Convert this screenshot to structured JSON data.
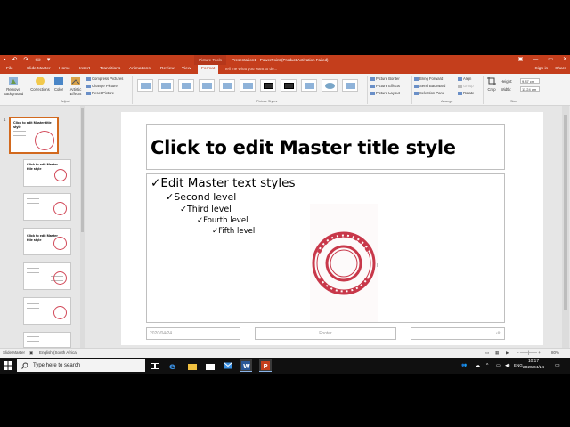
{
  "window": {
    "context_tab": "Picture Tools",
    "title": "Presentation1 - PowerPoint (Product Activation Failed)",
    "controls": [
      "—",
      "▭",
      "✕"
    ]
  },
  "tabs": [
    "File",
    "Slide Master",
    "Home",
    "Insert",
    "Transitions",
    "Animations",
    "Review",
    "View",
    "Format"
  ],
  "active_tab": "Format",
  "tell_me": "Tell me what you want to do...",
  "account": {
    "sign_in": "Sign in",
    "share": "Share"
  },
  "ribbon": {
    "remove_background": "Remove Background",
    "corrections": "Corrections",
    "color": "Color",
    "artistic_effects": "Artistic Effects",
    "compress": "Compress Pictures",
    "change": "Change Picture",
    "reset": "Reset Picture",
    "adjust_group": "Adjust",
    "styles_group": "Picture Styles",
    "picture_border": "Picture Border",
    "picture_effects": "Picture Effects",
    "picture_layout": "Picture Layout",
    "bring_forward": "Bring Forward",
    "send_backward": "Send Backward",
    "selection_pane": "Selection Pane",
    "align": "Align",
    "group": "Group",
    "rotate": "Rotate",
    "arrange_group": "Arrange",
    "crop": "Crop",
    "height_label": "Height:",
    "height_value": "9.87 cm",
    "width_label": "Width:",
    "width_value": "11.24 cm",
    "size_group": "Size"
  },
  "pane": {
    "numbers": [
      "1"
    ],
    "master_title": "Click to edit Master title style",
    "layout_title_a": "Click to edit Master title style",
    "layout_title_b": "Click to edit Master title style"
  },
  "slide": {
    "title": "Click to edit Master title style",
    "levels": [
      "Edit Master text styles",
      "Second level",
      "Third level",
      "Fourth level",
      "Fifth level"
    ],
    "date": "2020/04/24",
    "footer": "Footer",
    "page": "‹#›"
  },
  "status": {
    "view": "Slide Master",
    "language": "English (South Africa)",
    "zoom": "80%"
  },
  "taskbar": {
    "search": "Type here to search",
    "lang": "ENG",
    "time": "10:17",
    "date": "2020/04/24"
  },
  "colors": {
    "accent": "#c43e1c",
    "seal": "#c8384a"
  }
}
